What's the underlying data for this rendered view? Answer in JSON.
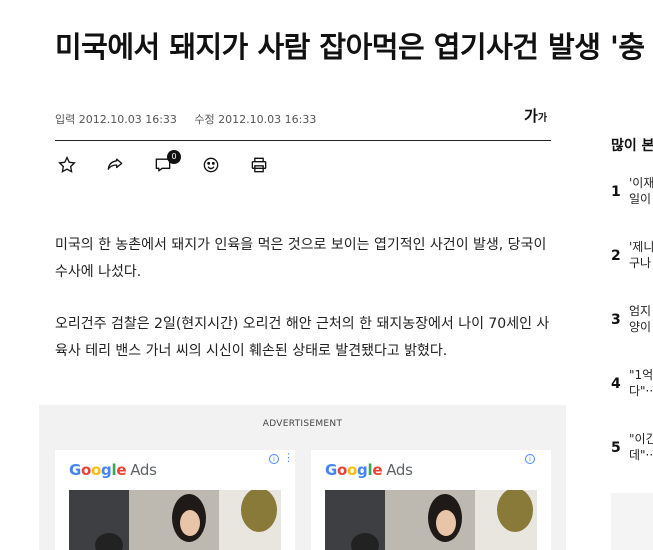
{
  "article": {
    "headline": "미국에서 돼지가 사람 잡아먹은 엽기사건 발생 '충",
    "meta": {
      "published": "입력 2012.10.03 16:33",
      "modified": "수정 2012.10.03 16:33"
    },
    "font_size_big": "가",
    "font_size_small": "가",
    "comment_count": "0",
    "paragraphs": [
      "미국의 한 농촌에서 돼지가 인육을 먹은 것으로 보이는 엽기적인 사건이 발생, 당국이 수사에 나섰다.",
      "오리건주 검찰은 2일(현지시간) 오리건 해안 근처의 한 돼지농장에서 나이 70세인 사육사 테리 밴스 가너 씨의 시신이 훼손된 상태로 발견됐다고 밝혔다."
    ]
  },
  "toolbar": {
    "icons": [
      "star-icon",
      "share-icon",
      "comment-icon",
      "smile-icon",
      "print-icon"
    ]
  },
  "ad": {
    "label": "ADVERTISEMENT",
    "cards": [
      {
        "brand": "Google",
        "suffix": "Ads"
      },
      {
        "brand": "Google",
        "suffix": "Ads"
      }
    ],
    "brand_colors": [
      "#4285F4",
      "#EA4335",
      "#FBBC05",
      "#4285F4",
      "#34A853",
      "#EA4335"
    ]
  },
  "sidebar": {
    "title": "많이 본",
    "items": [
      {
        "rank": "1",
        "line1": "'이재",
        "line2": "일이"
      },
      {
        "rank": "2",
        "line1": "'제니",
        "line2": "구나"
      },
      {
        "rank": "3",
        "line1": "엄지",
        "line2": "양이"
      },
      {
        "rank": "4",
        "line1": "\"1억",
        "line2": "다\"···"
      },
      {
        "rank": "5",
        "line1": "\"이긴",
        "line2": "데\"···"
      }
    ]
  }
}
